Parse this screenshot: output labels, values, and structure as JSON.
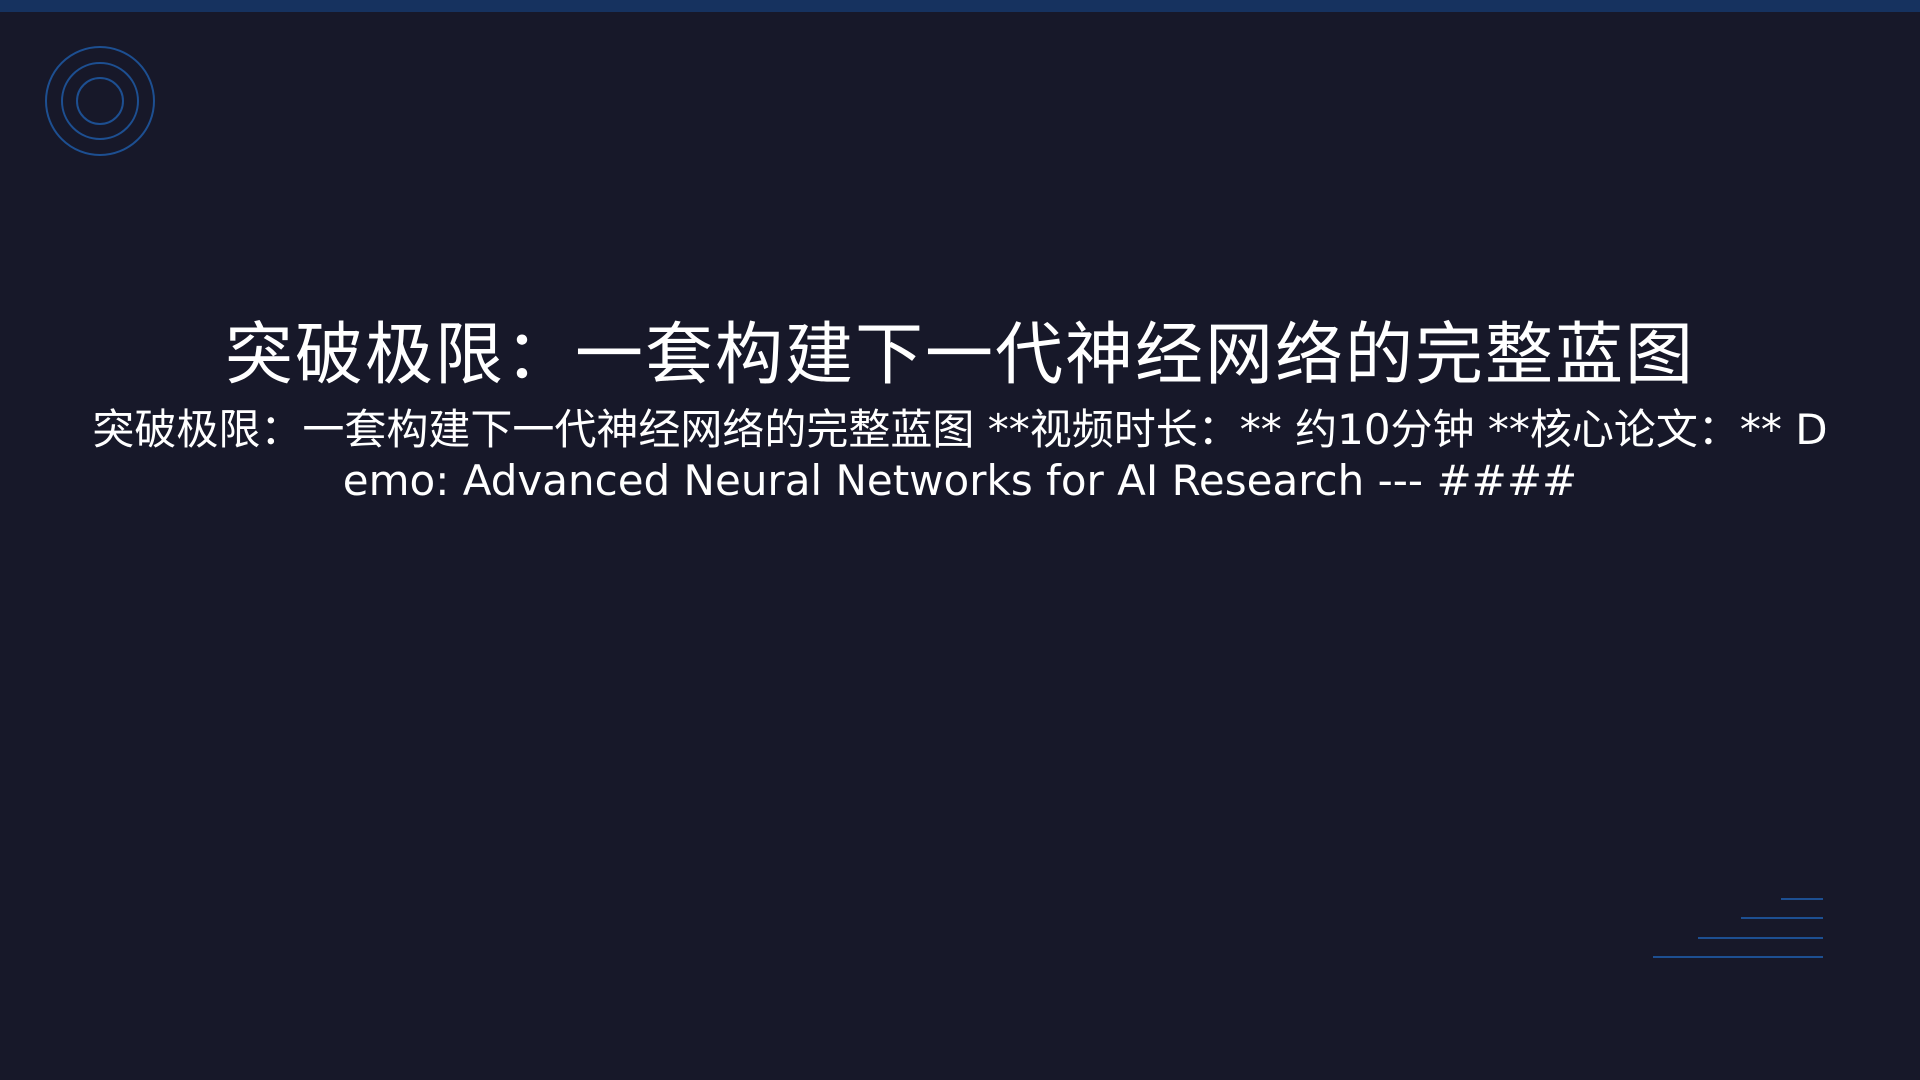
{
  "slide": {
    "title": "突破极限：一套构建下一代神经网络的完整蓝图",
    "subtitle": "突破极限：一套构建下一代神经网络的完整蓝图 **视频时长：** 约10分钟 **核心论文：** Demo: Advanced Neural Networks for AI Research --- ####"
  },
  "decorations": {
    "corner_icon": "concentric-rings-icon",
    "lines_icon": "stacked-lines-icon"
  },
  "colors": {
    "background": "#171829",
    "top_bar": "#16325f",
    "accent_line": "#1d4f91",
    "text": "#ffffff"
  }
}
